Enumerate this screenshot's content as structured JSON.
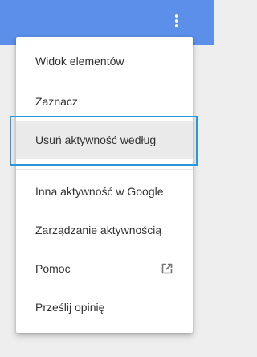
{
  "app_bar": {
    "color": "#5b8fe9",
    "more_icon": "more-vert-icon"
  },
  "menu": {
    "items": [
      {
        "label": "Widok elementów"
      },
      {
        "label": "Zaznacz"
      },
      {
        "label": "Usuń aktywność według",
        "highlighted": true
      },
      {
        "label": "Inna aktywność w Google"
      },
      {
        "label": "Zarządzanie aktywnością"
      },
      {
        "label": "Pomoc",
        "icon": "open-in-new-icon"
      },
      {
        "label": "Prześlij opinię"
      }
    ]
  },
  "colors": {
    "focus_ring": "#2a96dc",
    "highlight": "#eaeaea",
    "text": "#333333"
  }
}
